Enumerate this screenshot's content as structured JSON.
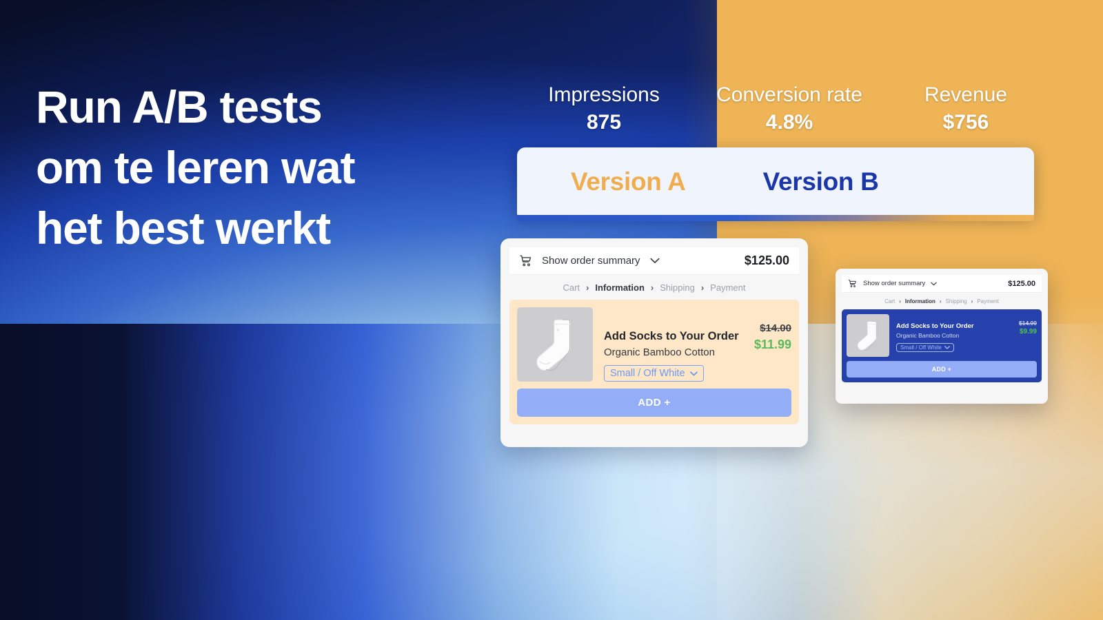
{
  "headline": {
    "lines": [
      "Run A/B tests",
      "om te leren wat",
      "het best werkt"
    ]
  },
  "metrics": [
    {
      "label": "Impressions",
      "value": "875"
    },
    {
      "label": "Conversion rate",
      "value": "4.8%"
    },
    {
      "label": "Revenue",
      "value": "$756"
    }
  ],
  "tabs": [
    {
      "label": "Version A",
      "color": "#efad4f"
    },
    {
      "label": "Version B",
      "color": "#1a36a8"
    }
  ],
  "checkout": {
    "summary_label": "Show order summary",
    "order_total": "$125.00",
    "breadcrumb": [
      "Cart",
      "Information",
      "Shipping",
      "Payment"
    ],
    "breadcrumb_active": "Information",
    "breadcrumb_separator": "›",
    "offer": {
      "title": "Add Socks to Your Order",
      "subtitle": "Organic Bamboo Cotton",
      "variant": "Small / Off White",
      "price_old": "$14.00",
      "add_label": "ADD +"
    },
    "variant_a_price": "$11.99",
    "variant_b_price": "$9.99"
  },
  "colors": {
    "amber": "#efad4f",
    "deep_blue": "#1a36a8",
    "offer_bg_a": "#fde7c6",
    "offer_bg_b": "#2741ac",
    "add_button": "#93aef6",
    "price_green": "#5cb85c",
    "panel_bg": "#f0f5fd"
  }
}
